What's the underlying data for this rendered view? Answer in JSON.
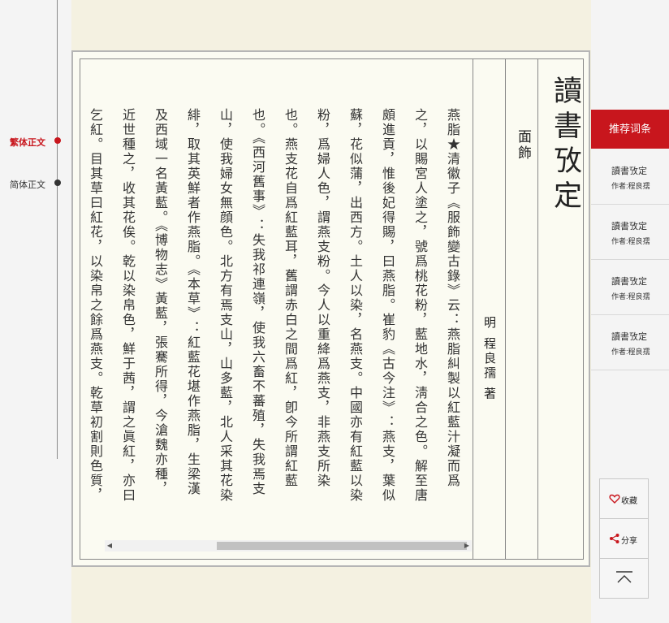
{
  "left_nav": {
    "items": [
      {
        "label": "繁体正文",
        "active": true
      },
      {
        "label": "简体正文",
        "active": false
      }
    ]
  },
  "book": {
    "title": "讀書攷定",
    "chapter": "面飾",
    "author": "明 程良孺 著",
    "body_lines": [
      "燕脂★清徽子《服飾變古錄》云：燕脂糾製以紅藍汁凝而爲",
      "之，以賜宮人塗之，號爲桃花粉，藍地水，淸合之色。解至唐",
      "頗進貢，惟後妃得賜，曰燕脂。崔豹《古今注》：燕支，葉似",
      "蘇，花似蒲，出西方。土人以染，名燕支。中國亦有紅藍以染",
      "粉，爲婦人色，謂燕支粉。今人以重絳爲燕支，非燕支所染",
      "也。燕支花自爲紅藍耳，舊謂赤白之間爲紅，卽今所謂紅藍",
      "也。《西河舊事》：失我祁連嶺，使我六畜不蕃殖，失我焉支",
      "山，使我婦女無顔色。北方有焉支山，山多藍，北人采其花染",
      "緋，取其英鮮者作燕脂。《本草》：紅藍花堪作燕脂，生梁漢",
      "及西域一名黃藍。《博物志》黃藍，張騫所得，今滄魏亦種，",
      "近世種之，收其花俟。乾以染帛色，鮮于茜，謂之眞紅，亦曰",
      "乞紅。目其草曰紅花，以染帛之餘爲燕支。乾草初割則色質，"
    ]
  },
  "scrollbar": {
    "left_arrow": "◀",
    "right_arrow": "▶"
  },
  "sidebar": {
    "header": "推荐词条",
    "items": [
      {
        "title": "讀書攷定",
        "author": "作者:程良孺"
      },
      {
        "title": "讀書攷定",
        "author": "作者:程良孺"
      },
      {
        "title": "讀書攷定",
        "author": "作者:程良孺"
      },
      {
        "title": "讀書攷定",
        "author": "作者:程良孺"
      }
    ]
  },
  "actions": {
    "favorite_label": "收藏",
    "share_label": "分享",
    "favorite_icon": "heart-icon",
    "share_icon": "share-icon",
    "top_icon": "back-to-top-icon"
  },
  "colors": {
    "accent": "#c8161d",
    "paper": "#fbfbf2",
    "page_bg": "#f4f1e1"
  }
}
